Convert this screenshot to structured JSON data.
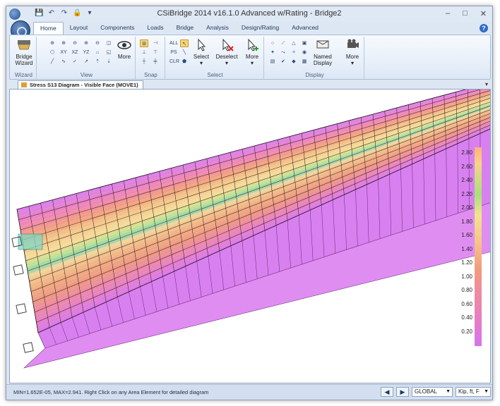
{
  "window": {
    "title": "CSiBridge 2014 v16.1.0 Advanced w/Rating  - Bridge2",
    "controls": [
      "–",
      "□",
      "✕"
    ]
  },
  "quick_access": [
    "💾",
    "↶",
    "↷",
    "🔒",
    "▾"
  ],
  "tabs": [
    {
      "label": "Home",
      "active": true
    },
    {
      "label": "Layout"
    },
    {
      "label": "Components"
    },
    {
      "label": "Loads"
    },
    {
      "label": "Bridge"
    },
    {
      "label": "Analysis"
    },
    {
      "label": "Design/Rating"
    },
    {
      "label": "Advanced"
    }
  ],
  "ribbon": {
    "wizard": {
      "button": "Bridge\nWizard",
      "group": "Wizard"
    },
    "view": {
      "mini_labels": [
        "XY",
        "XZ",
        "YZ"
      ],
      "more": "More",
      "group": "View"
    },
    "snap": {
      "group": "Snap"
    },
    "select": {
      "all": "ALL",
      "ps": "PS",
      "clr": "CLR",
      "select": "Select",
      "deselect": "Deselect",
      "more": "More",
      "group": "Select"
    },
    "display": {
      "named": "Named\nDisplay",
      "more": "More",
      "group": "Display"
    }
  },
  "document_tab": {
    "title": "Stress S13 Diagram - Visible Face  (MOVE1)"
  },
  "legend": {
    "values": [
      "2.80",
      "2.60",
      "2.40",
      "2.20",
      "2.00",
      "1.80",
      "1.60",
      "1.40",
      "1.20",
      "1.00",
      "0.80",
      "0.60",
      "0.40",
      "0.20"
    ]
  },
  "status": {
    "message": "MIN=1.652E-05, MAX=2.941. Right Click on any Area Element for detailed diagram",
    "coord_system": "GLOBAL",
    "units": "Kip, ft, F"
  },
  "colors": {
    "accent": "#2f6cc2",
    "deck_side": "#d57ef0",
    "stress_high": "#a8e07a",
    "stress_mid": "#f09a7f",
    "stress_low": "#d574ec"
  }
}
